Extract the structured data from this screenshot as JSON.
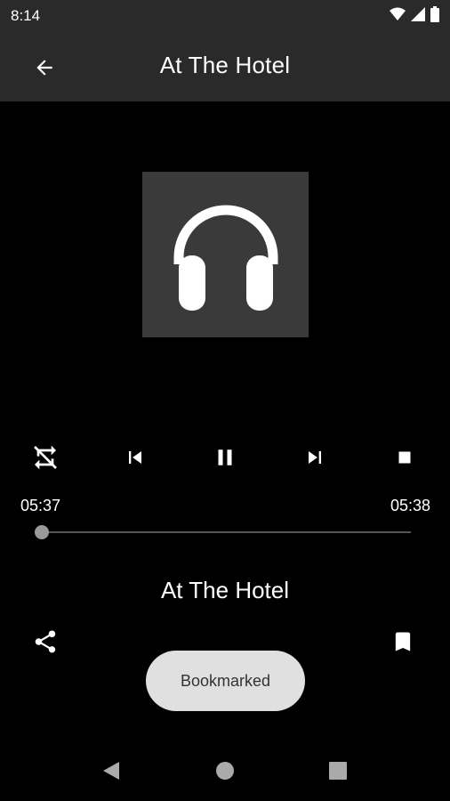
{
  "status_bar": {
    "time": "8:14",
    "icons": [
      "wifi-icon",
      "signal-icon",
      "battery-icon"
    ]
  },
  "app_bar": {
    "title": "At The Hotel",
    "back_icon": "arrow-back-icon"
  },
  "artwork": {
    "icon": "headphones-icon",
    "background": "#3a3a3a"
  },
  "controls": {
    "items": [
      "shuffle-off-icon",
      "skip-previous-icon",
      "pause-icon",
      "skip-next-icon",
      "stop-icon"
    ]
  },
  "progress": {
    "elapsed": "05:37",
    "total": "05:38",
    "fraction": 0
  },
  "track": {
    "title": "At The Hotel"
  },
  "actions": {
    "share_icon": "share-icon",
    "bookmark_icon": "bookmark-icon"
  },
  "toast": {
    "text": "Bookmarked"
  },
  "nav_bar": {
    "items": [
      "back-triangle-icon",
      "home-circle-icon",
      "recents-square-icon"
    ]
  },
  "colors": {
    "bar_background": "#2a2a2a",
    "background": "#000000",
    "toast_background": "#e0e0e0"
  }
}
